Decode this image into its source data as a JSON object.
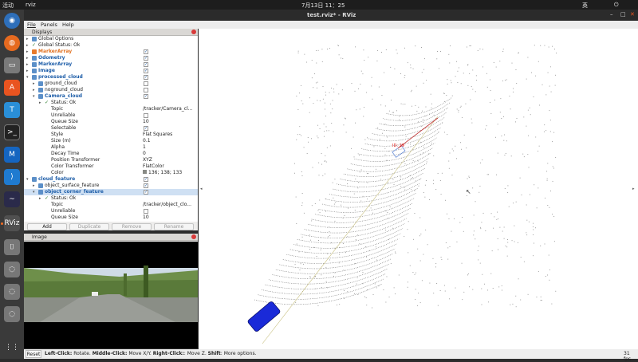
{
  "topbar": {
    "activities": "活动",
    "app": "rviz",
    "clock": "7月13日 11：25",
    "lang": "英"
  },
  "window": {
    "title": "test.rviz* - RViz"
  },
  "menu": {
    "file": "File",
    "panels": "Panels",
    "help": "Help"
  },
  "displays": {
    "title": "Displays",
    "rows": [
      {
        "label": "Global Options",
        "value": "",
        "indent": 0,
        "icon": "#5b8fc8",
        "check": null,
        "arrow": "▸"
      },
      {
        "label": "Global Status: Ok",
        "value": "",
        "indent": 0,
        "icon": "check",
        "check": null,
        "arrow": "▸"
      },
      {
        "label": "MarkerArray",
        "value": "",
        "indent": 0,
        "icon": "#e87a2a",
        "check": true,
        "arrow": "▸",
        "color": "#e07020",
        "bold": true
      },
      {
        "label": "Odometry",
        "value": "",
        "indent": 0,
        "icon": "#5b8fc8",
        "check": true,
        "arrow": "▸",
        "color": "#1d5da8",
        "bold": true
      },
      {
        "label": "MarkerArray",
        "value": "",
        "indent": 0,
        "icon": "#5b8fc8",
        "check": true,
        "arrow": "▸",
        "color": "#1d5da8",
        "bold": true
      },
      {
        "label": "Image",
        "value": "",
        "indent": 0,
        "icon": "#5b8fc8",
        "check": true,
        "arrow": "▸",
        "color": "#1d5da8",
        "bold": true
      },
      {
        "label": "processed_cloud",
        "value": "",
        "indent": 0,
        "icon": "#5b8fc8",
        "check": true,
        "arrow": "▾",
        "color": "#1d5da8",
        "bold": true
      },
      {
        "label": "ground_cloud",
        "value": "",
        "indent": 1,
        "icon": "#5b8fc8",
        "check": false,
        "arrow": "▸"
      },
      {
        "label": "noground_cloud",
        "value": "",
        "indent": 1,
        "icon": "#5b8fc8",
        "check": false,
        "arrow": "▸"
      },
      {
        "label": "Camera_cloud",
        "value": "",
        "indent": 1,
        "icon": "#5b8fc8",
        "check": true,
        "arrow": "▾",
        "color": "#1d5da8",
        "bold": true
      },
      {
        "label": "Status: Ok",
        "value": "",
        "indent": 2,
        "icon": "check",
        "check": null,
        "arrow": "▸"
      },
      {
        "label": "Topic",
        "value": "/tracker/Camera_cl...",
        "indent": 2,
        "icon": null,
        "check": null,
        "arrow": ""
      },
      {
        "label": "Unreliable",
        "value": "",
        "indent": 2,
        "icon": null,
        "check": false,
        "arrow": ""
      },
      {
        "label": "Queue Size",
        "value": "10",
        "indent": 2,
        "icon": null,
        "check": null,
        "arrow": ""
      },
      {
        "label": "Selectable",
        "value": "",
        "indent": 2,
        "icon": null,
        "check": true,
        "arrow": ""
      },
      {
        "label": "Style",
        "value": "Flat Squares",
        "indent": 2,
        "icon": null,
        "check": null,
        "arrow": ""
      },
      {
        "label": "Size (m)",
        "value": "0.1",
        "indent": 2,
        "icon": null,
        "check": null,
        "arrow": ""
      },
      {
        "label": "Alpha",
        "value": "1",
        "indent": 2,
        "icon": null,
        "check": null,
        "arrow": ""
      },
      {
        "label": "Decay Time",
        "value": "0",
        "indent": 2,
        "icon": null,
        "check": null,
        "arrow": ""
      },
      {
        "label": "Position Transformer",
        "value": "XYZ",
        "indent": 2,
        "icon": null,
        "check": null,
        "arrow": ""
      },
      {
        "label": "Color Transformer",
        "value": "FlatColor",
        "indent": 2,
        "icon": null,
        "check": null,
        "arrow": ""
      },
      {
        "label": "Color",
        "value": "136; 138; 133",
        "indent": 2,
        "icon": null,
        "check": null,
        "arrow": "",
        "swatch": "#888a85"
      },
      {
        "label": "cloud_feature",
        "value": "",
        "indent": 0,
        "icon": "#5b8fc8",
        "check": true,
        "arrow": "▾",
        "color": "#1d5da8",
        "bold": true
      },
      {
        "label": "object_surface_feature",
        "value": "",
        "indent": 1,
        "icon": "#5b8fc8",
        "check": true,
        "arrow": "▸"
      },
      {
        "label": "object_corner_feature",
        "value": "",
        "indent": 1,
        "icon": "#5b8fc8",
        "check": true,
        "arrow": "▾",
        "color": "#1d5da8",
        "bold": true,
        "selected": true
      },
      {
        "label": "Status: Ok",
        "value": "",
        "indent": 2,
        "icon": "check",
        "check": null,
        "arrow": "▸"
      },
      {
        "label": "Topic",
        "value": "/tracker/object_clo...",
        "indent": 2,
        "icon": null,
        "check": null,
        "arrow": ""
      },
      {
        "label": "Unreliable",
        "value": "",
        "indent": 2,
        "icon": null,
        "check": false,
        "arrow": ""
      },
      {
        "label": "Queue Size",
        "value": "10",
        "indent": 2,
        "icon": null,
        "check": null,
        "arrow": ""
      }
    ],
    "buttons": {
      "add": "Add",
      "duplicate": "Duplicate",
      "remove": "Remove",
      "rename": "Rename"
    }
  },
  "image_panel": {
    "title": "Image"
  },
  "viewport": {
    "marker_label": "ID: 29"
  },
  "status": {
    "reset": "Reset",
    "hint_parts": [
      {
        "text": "Left-Click:",
        "bold": true
      },
      {
        "text": " Rotate. ",
        "bold": false
      },
      {
        "text": "Middle-Click:",
        "bold": true
      },
      {
        "text": " Move X/Y. ",
        "bold": false
      },
      {
        "text": "Right-Click:",
        "bold": true
      },
      {
        "text": ": Move Z. ",
        "bold": false
      },
      {
        "text": "Shift",
        "bold": true
      },
      {
        "text": ": More options.",
        "bold": false
      }
    ],
    "fps": "31 fps"
  }
}
